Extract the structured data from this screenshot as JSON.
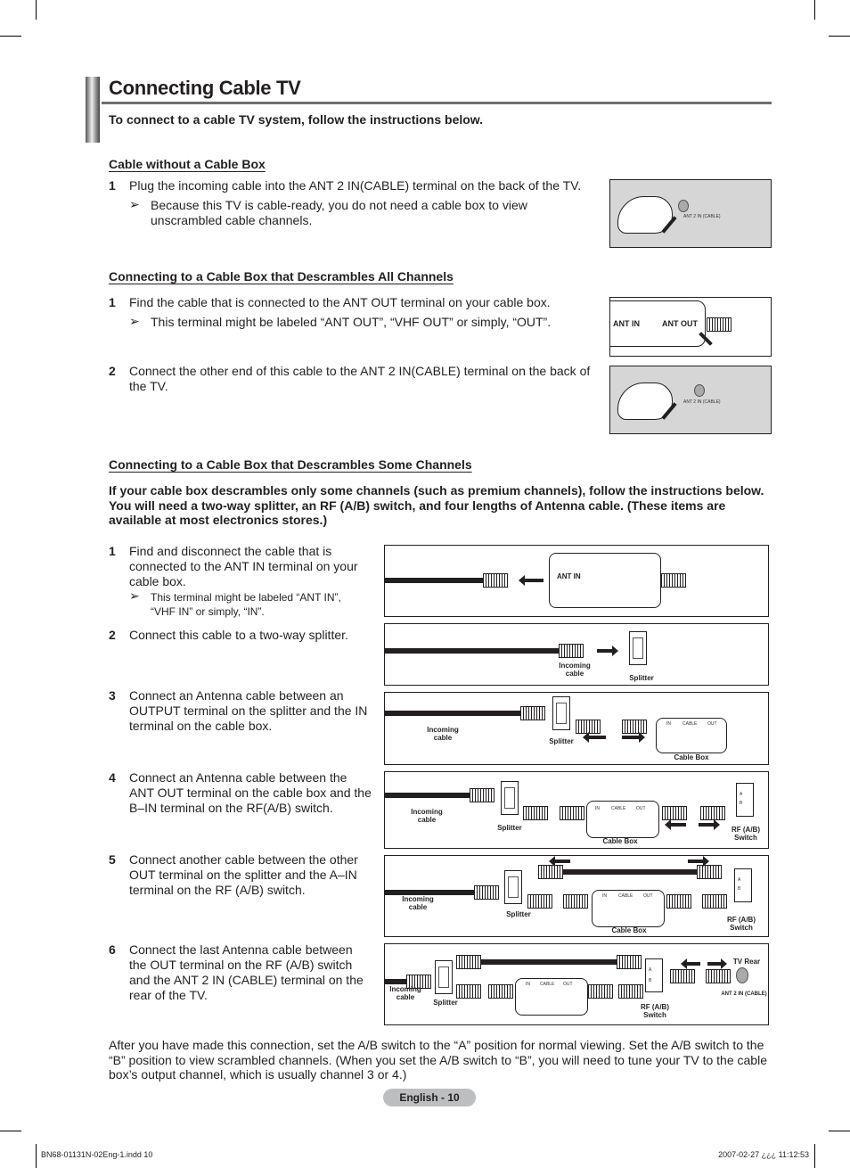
{
  "page": {
    "title": "Connecting Cable TV",
    "intro": "To connect to a cable TV system, follow the instructions below."
  },
  "section1": {
    "heading": "Cable without a Cable Box",
    "step1_num": "1",
    "step1": "Plug the incoming cable into the ANT 2 IN(CABLE) terminal on the back of the TV.",
    "note_arrow": "➢",
    "note": "Because this TV is cable-ready, you do not need a cable box to view unscrambled cable channels.",
    "figure_label": "ANT 2 IN (CABLE)"
  },
  "section2": {
    "heading": "Connecting to a Cable Box that Descrambles All Channels",
    "step1_num": "1",
    "step1": "Find the cable that is connected to the ANT OUT terminal on your cable box.",
    "note_arrow": "➢",
    "note": "This terminal might be labeled “ANT OUT”, “VHF OUT” or simply, “OUT”.",
    "step2_num": "2",
    "step2": "Connect the other end of this cable to the ANT 2 IN(CABLE) terminal on the back of the TV.",
    "fig1_ant_in": "ANT IN",
    "fig1_ant_out": "ANT OUT",
    "fig2_label": "ANT 2 IN (CABLE)"
  },
  "section3": {
    "heading": "Connecting to a Cable Box that Descrambles Some Channels",
    "intro": "If your cable box descrambles only some channels (such as premium channels), follow the instructions below. You will need a two-way splitter, an RF (A/B) switch, and four lengths of Antenna cable. (These items are available at most electronics stores.)",
    "steps": [
      {
        "num": "1",
        "text": "Find and disconnect the cable that is connected to the ANT IN terminal on your cable box.",
        "note": "This terminal might be labeled “ANT IN”, “VHF IN” or simply, “IN”."
      },
      {
        "num": "2",
        "text": "Connect this cable to a two-way splitter."
      },
      {
        "num": "3",
        "text": "Connect an Antenna cable between an OUTPUT terminal on the splitter and the IN terminal on the cable box."
      },
      {
        "num": "4",
        "text": "Connect an Antenna cable between the ANT OUT terminal on the cable box and the B–IN terminal on the RF(A/B) switch."
      },
      {
        "num": "5",
        "text": "Connect another cable between the other OUT terminal on the splitter and the A–IN terminal on the RF (A/B) switch."
      },
      {
        "num": "6",
        "text": "Connect the last Antenna cable between the OUT terminal on the RF (A/B) switch and the ANT 2 IN (CABLE) terminal on the rear of the TV."
      }
    ],
    "note_arrow": "➢",
    "labels": {
      "ant_in": "ANT IN",
      "incoming_cable": "Incoming cable",
      "splitter": "Splitter",
      "cable_box": "Cable Box",
      "rf_switch": "RF (A/B) Switch",
      "tv_rear": "TV Rear",
      "ant2_in": "ANT 2 IN (CABLE)",
      "box_in": "IN",
      "box_cable": "CABLE",
      "box_out": "OUT",
      "switch_a": "A",
      "switch_b": "B"
    },
    "closing": "After you have made this connection, set the A/B switch to the “A” position for normal viewing. Set the A/B switch to the “B” position to view scrambled channels. (When you set the A/B switch to “B”, you will need to tune your TV to the cable box’s output channel, which is usually channel 3 or 4.)"
  },
  "footer": {
    "page_label": "English - 10",
    "file": "BN68-01131N-02Eng-1.indd   10",
    "timestamp": "2007-02-27   ¿¿¿ 11:12:53"
  }
}
